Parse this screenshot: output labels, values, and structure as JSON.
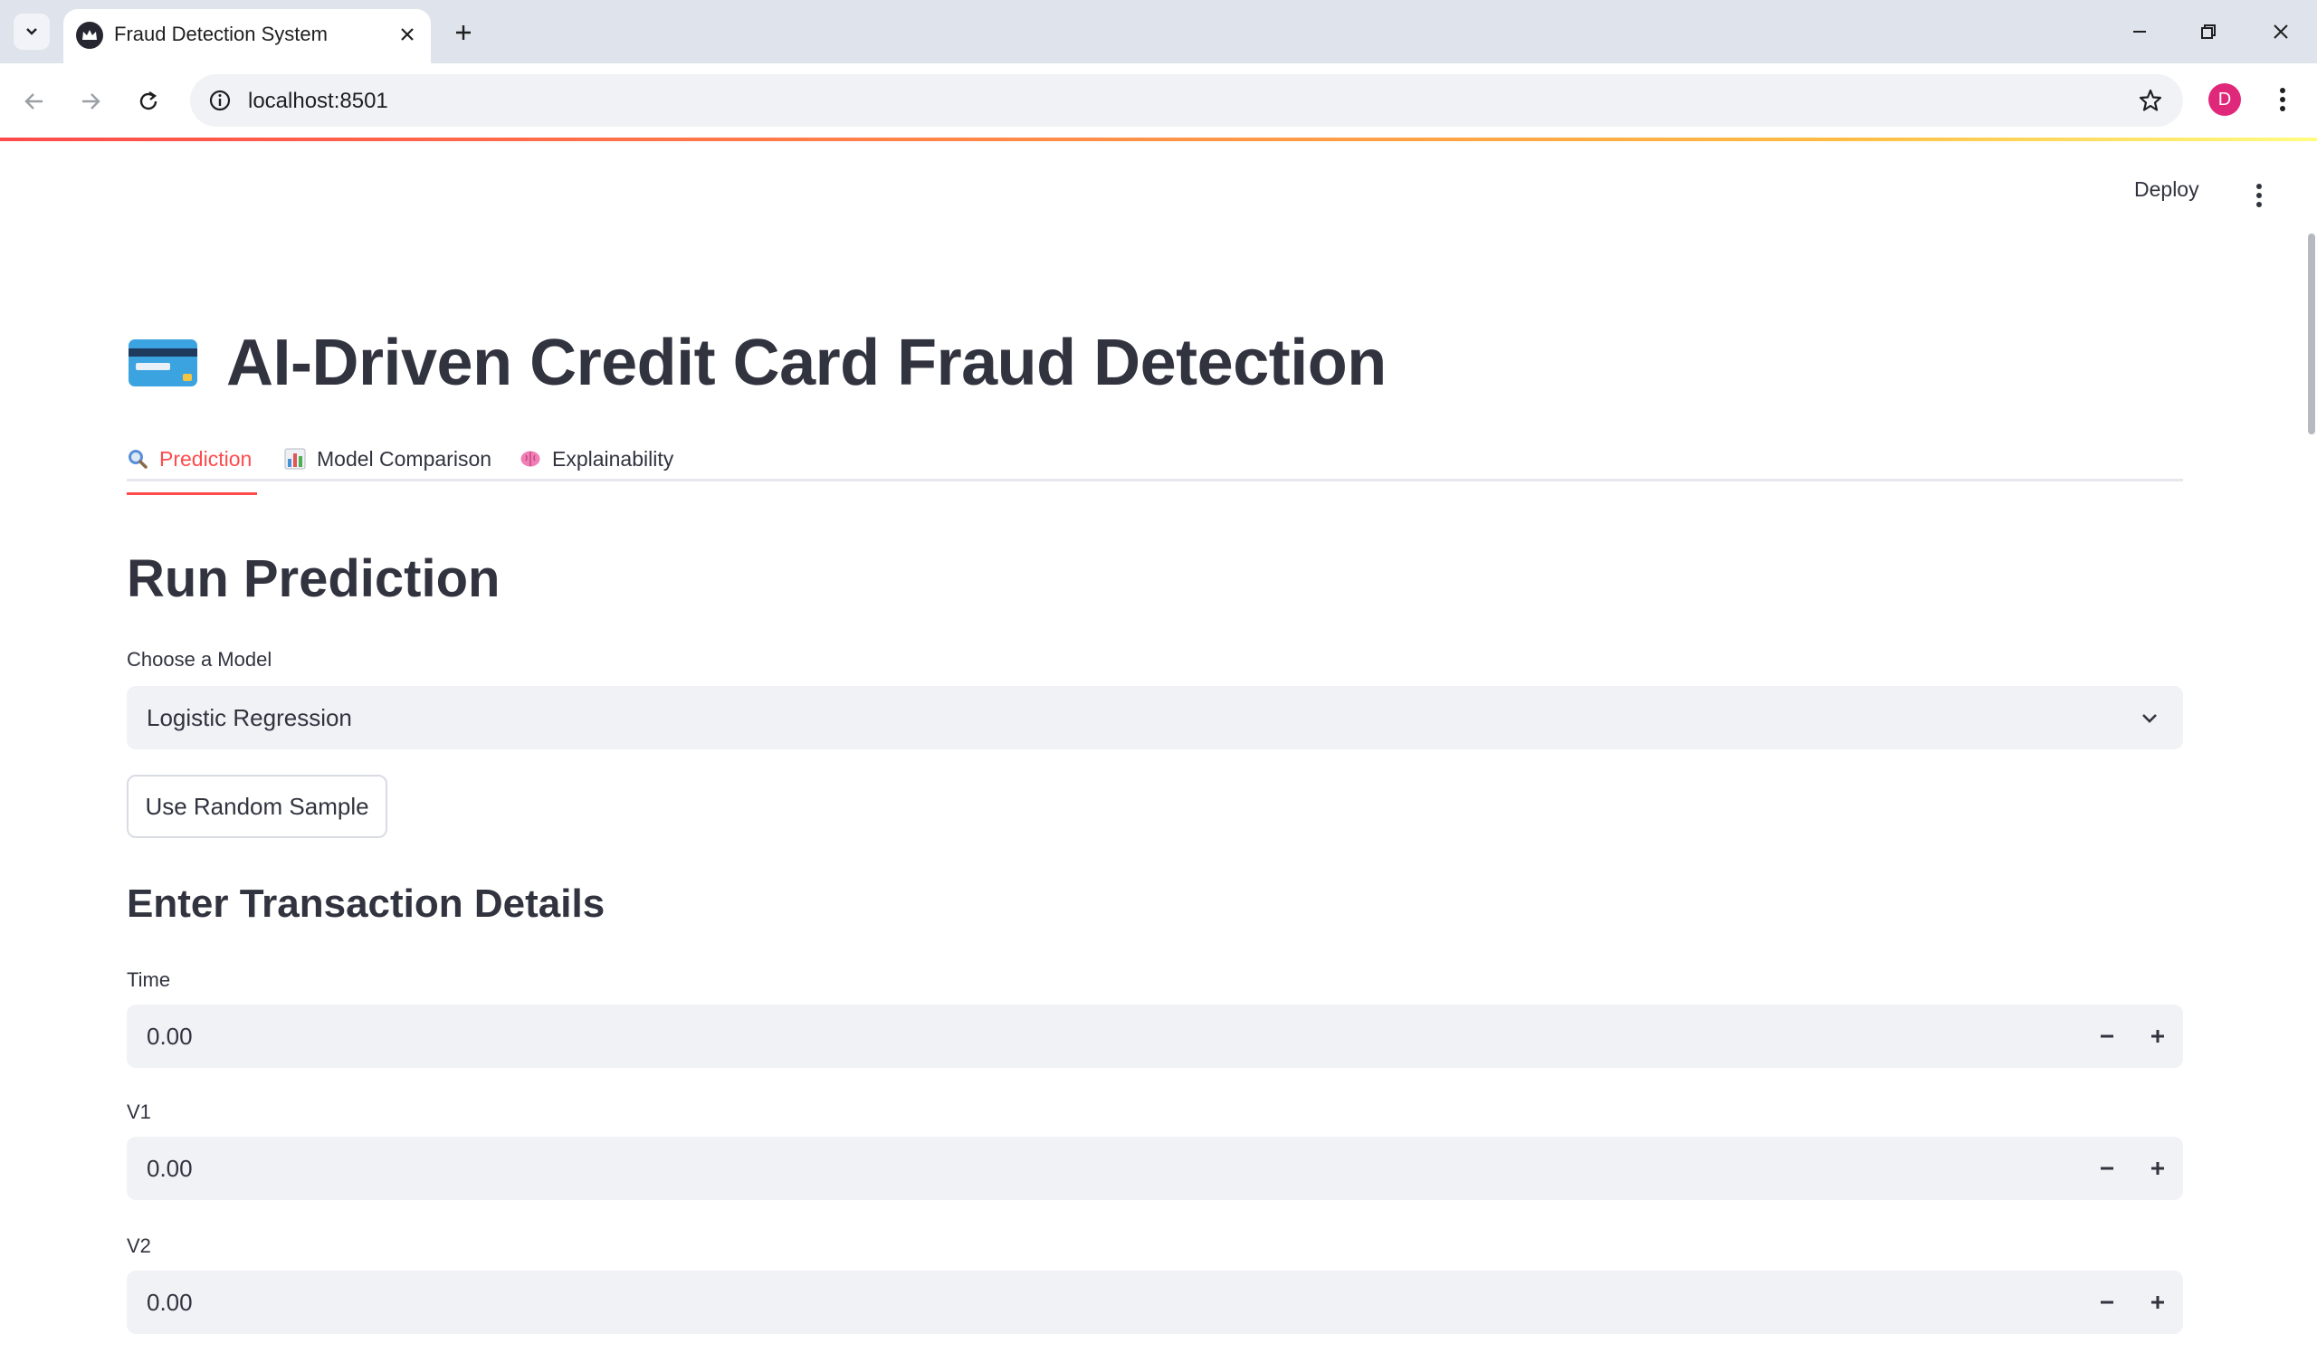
{
  "browser": {
    "tab_title": "Fraud Detection System",
    "url": "localhost:8501",
    "avatar_letter": "D"
  },
  "header": {
    "deploy_label": "Deploy"
  },
  "page": {
    "title": "AI-Driven Credit Card Fraud Detection",
    "tabs": [
      {
        "label": "Prediction",
        "icon": "magnifier-icon",
        "active": true
      },
      {
        "label": "Model Comparison",
        "icon": "bar-chart-icon",
        "active": false
      },
      {
        "label": "Explainability",
        "icon": "brain-icon",
        "active": false
      }
    ],
    "section_heading": "Run Prediction",
    "model_select": {
      "label": "Choose a Model",
      "value": "Logistic Regression"
    },
    "random_sample_button": "Use Random Sample",
    "details_heading": "Enter Transaction Details",
    "fields": [
      {
        "label": "Time",
        "value": "0.00"
      },
      {
        "label": "V1",
        "value": "0.00"
      },
      {
        "label": "V2",
        "value": "0.00"
      }
    ]
  },
  "colors": {
    "accent": "#ff4b4b",
    "text": "#31333f",
    "input_bg": "#f0f2f6"
  }
}
